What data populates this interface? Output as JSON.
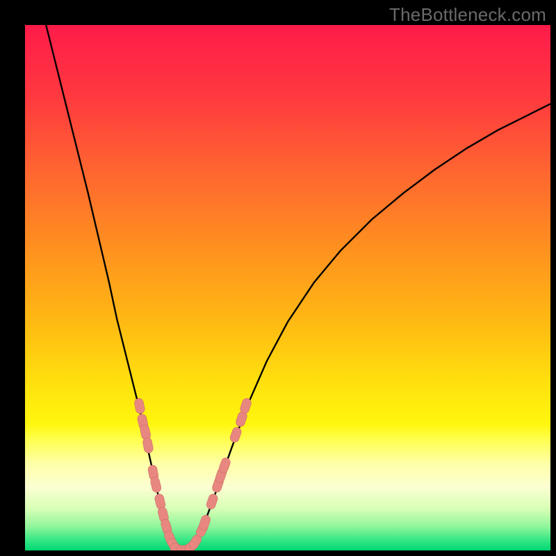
{
  "watermark": "TheBottleneck.com",
  "colors": {
    "frame": "#000000",
    "watermark": "#6a6a6a",
    "curve_stroke": "#000000",
    "marker_fill": "#e8877f",
    "marker_stroke": "#c46a63",
    "gradient_stops": [
      {
        "offset": 0.0,
        "color": "#ff1b4a"
      },
      {
        "offset": 0.14,
        "color": "#ff3a3f"
      },
      {
        "offset": 0.28,
        "color": "#ff6630"
      },
      {
        "offset": 0.42,
        "color": "#ff8f20"
      },
      {
        "offset": 0.56,
        "color": "#ffb813"
      },
      {
        "offset": 0.68,
        "color": "#ffe00e"
      },
      {
        "offset": 0.76,
        "color": "#fff70e"
      },
      {
        "offset": 0.79,
        "color": "#ffff52"
      },
      {
        "offset": 0.835,
        "color": "#ffffa8"
      },
      {
        "offset": 0.88,
        "color": "#fbffd2"
      },
      {
        "offset": 0.92,
        "color": "#d8ffb6"
      },
      {
        "offset": 0.955,
        "color": "#8ff59a"
      },
      {
        "offset": 0.978,
        "color": "#3de887"
      },
      {
        "offset": 1.0,
        "color": "#00d874"
      }
    ]
  },
  "chart_data": {
    "type": "line",
    "title": "",
    "xlabel": "",
    "ylabel": "",
    "xlim": [
      0,
      100
    ],
    "ylim": [
      0,
      100
    ],
    "grid": false,
    "series": [
      {
        "name": "left-branch",
        "x": [
          4.0,
          6.0,
          8.0,
          10.0,
          12.0,
          14.0,
          16.0,
          17.5,
          19.0,
          20.5,
          22.0,
          23.0,
          24.0,
          25.0,
          25.8,
          26.5,
          27.2,
          27.8
        ],
        "y": [
          100.0,
          92.0,
          84.0,
          76.0,
          68.0,
          59.5,
          51.0,
          44.0,
          38.0,
          32.0,
          26.0,
          21.0,
          16.5,
          12.0,
          8.5,
          5.5,
          3.0,
          1.4
        ]
      },
      {
        "name": "valley",
        "x": [
          27.8,
          28.5,
          29.2,
          30.0,
          30.8,
          31.6,
          32.4
        ],
        "y": [
          1.4,
          0.5,
          0.1,
          0.0,
          0.1,
          0.5,
          1.4
        ]
      },
      {
        "name": "right-branch",
        "x": [
          32.4,
          33.5,
          35.0,
          37.0,
          39.5,
          42.5,
          46.0,
          50.0,
          55.0,
          60.0,
          66.0,
          72.0,
          78.0,
          84.0,
          90.0,
          96.0,
          100.0
        ],
        "y": [
          1.4,
          3.5,
          7.5,
          13.0,
          20.0,
          28.0,
          36.0,
          43.5,
          51.0,
          57.0,
          63.0,
          68.0,
          72.5,
          76.5,
          80.0,
          83.0,
          85.0
        ]
      }
    ],
    "markers": {
      "name": "data-points",
      "points": [
        {
          "x": 21.8,
          "y": 27.5
        },
        {
          "x": 22.4,
          "y": 24.5
        },
        {
          "x": 22.9,
          "y": 22.5
        },
        {
          "x": 23.4,
          "y": 20.0
        },
        {
          "x": 24.4,
          "y": 14.8
        },
        {
          "x": 24.9,
          "y": 12.5
        },
        {
          "x": 25.7,
          "y": 9.3
        },
        {
          "x": 26.3,
          "y": 6.8
        },
        {
          "x": 26.9,
          "y": 4.5
        },
        {
          "x": 27.6,
          "y": 2.3
        },
        {
          "x": 28.3,
          "y": 1.0
        },
        {
          "x": 29.0,
          "y": 0.3
        },
        {
          "x": 30.3,
          "y": 0.1
        },
        {
          "x": 31.0,
          "y": 0.3
        },
        {
          "x": 31.7,
          "y": 0.8
        },
        {
          "x": 32.4,
          "y": 1.6
        },
        {
          "x": 33.7,
          "y": 4.0
        },
        {
          "x": 34.2,
          "y": 5.3
        },
        {
          "x": 35.6,
          "y": 9.3
        },
        {
          "x": 36.7,
          "y": 12.5
        },
        {
          "x": 37.3,
          "y": 14.3
        },
        {
          "x": 38.0,
          "y": 16.2
        },
        {
          "x": 40.1,
          "y": 22.0
        },
        {
          "x": 41.2,
          "y": 25.0
        },
        {
          "x": 42.0,
          "y": 27.5
        }
      ]
    }
  }
}
